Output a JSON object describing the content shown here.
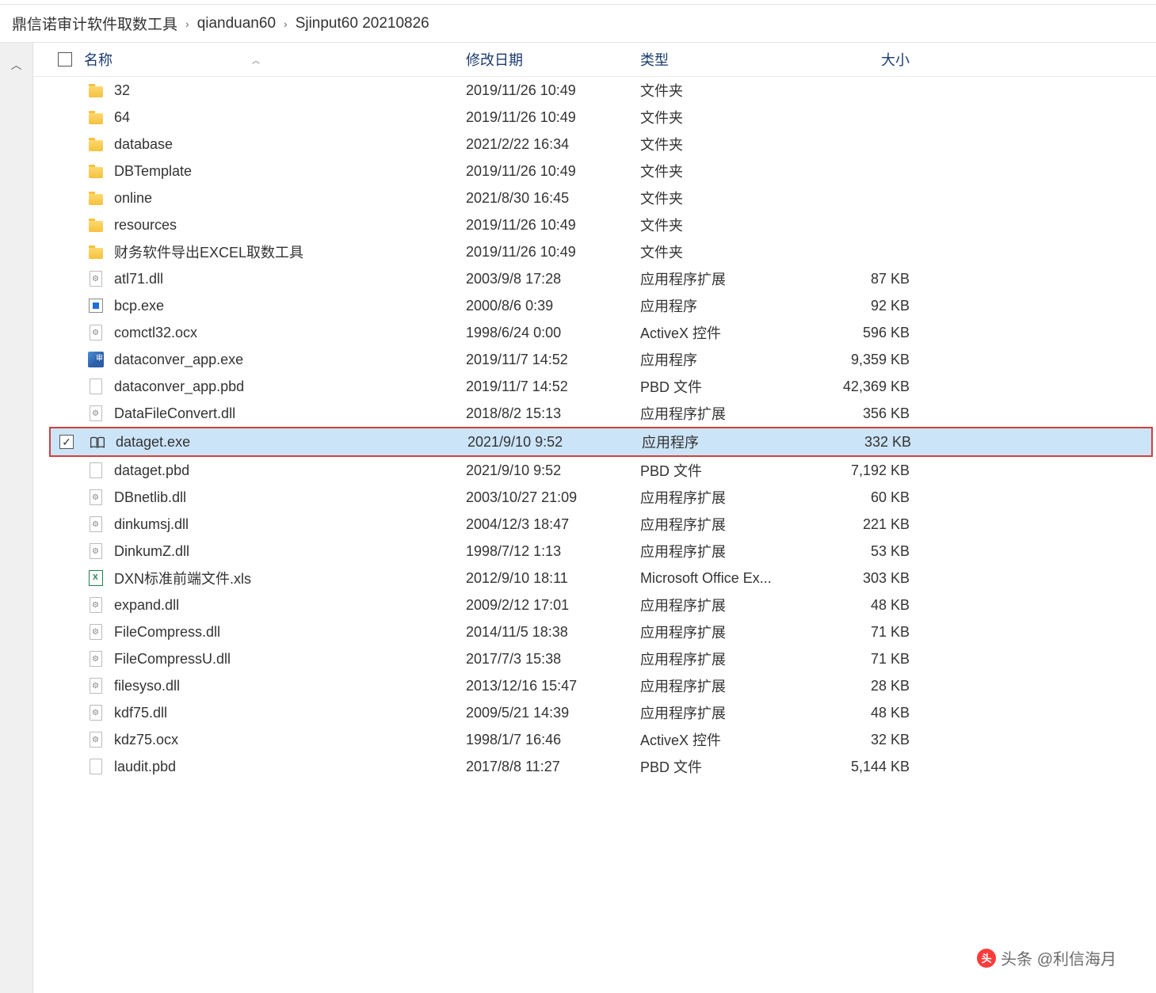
{
  "breadcrumb": {
    "item1": "鼎信诺审计软件取数工具",
    "item2": "qianduan60",
    "item3": "Sjinput60 20210826"
  },
  "columns": {
    "name": "名称",
    "date": "修改日期",
    "type": "类型",
    "size": "大小"
  },
  "types": {
    "folder": "文件夹",
    "appext": "应用程序扩展",
    "app": "应用程序",
    "activex": "ActiveX 控件",
    "pbd": "PBD 文件",
    "excel": "Microsoft Office Ex..."
  },
  "files": [
    {
      "icon": "folder",
      "name": "32",
      "date": "2019/11/26 10:49",
      "typekey": "folder",
      "size": ""
    },
    {
      "icon": "folder",
      "name": "64",
      "date": "2019/11/26 10:49",
      "typekey": "folder",
      "size": ""
    },
    {
      "icon": "folder",
      "name": "database",
      "date": "2021/2/22 16:34",
      "typekey": "folder",
      "size": ""
    },
    {
      "icon": "folder",
      "name": "DBTemplate",
      "date": "2019/11/26 10:49",
      "typekey": "folder",
      "size": ""
    },
    {
      "icon": "folder",
      "name": "online",
      "date": "2021/8/30 16:45",
      "typekey": "folder",
      "size": ""
    },
    {
      "icon": "folder",
      "name": "resources",
      "date": "2019/11/26 10:49",
      "typekey": "folder",
      "size": ""
    },
    {
      "icon": "folder",
      "name": "财务软件导出EXCEL取数工具",
      "date": "2019/11/26 10:49",
      "typekey": "folder",
      "size": ""
    },
    {
      "icon": "dll",
      "name": "atl71.dll",
      "date": "2003/9/8 17:28",
      "typekey": "appext",
      "size": "87 KB"
    },
    {
      "icon": "exe-blue",
      "name": "bcp.exe",
      "date": "2000/8/6 0:39",
      "typekey": "app",
      "size": "92 KB"
    },
    {
      "icon": "dll",
      "name": "comctl32.ocx",
      "date": "1998/6/24 0:00",
      "typekey": "activex",
      "size": "596 KB"
    },
    {
      "icon": "exe-color",
      "name": "dataconver_app.exe",
      "date": "2019/11/7 14:52",
      "typekey": "app",
      "size": "9,359 KB"
    },
    {
      "icon": "file",
      "name": "dataconver_app.pbd",
      "date": "2019/11/7 14:52",
      "typekey": "pbd",
      "size": "42,369 KB"
    },
    {
      "icon": "dll",
      "name": "DataFileConvert.dll",
      "date": "2018/8/2 15:13",
      "typekey": "appext",
      "size": "356 KB"
    },
    {
      "icon": "book",
      "name": "dataget.exe",
      "date": "2021/9/10 9:52",
      "typekey": "app",
      "size": "332 KB",
      "selected": true,
      "highlighted": true
    },
    {
      "icon": "file",
      "name": "dataget.pbd",
      "date": "2021/9/10 9:52",
      "typekey": "pbd",
      "size": "7,192 KB"
    },
    {
      "icon": "dll",
      "name": "DBnetlib.dll",
      "date": "2003/10/27 21:09",
      "typekey": "appext",
      "size": "60 KB"
    },
    {
      "icon": "dll",
      "name": "dinkumsj.dll",
      "date": "2004/12/3 18:47",
      "typekey": "appext",
      "size": "221 KB"
    },
    {
      "icon": "dll",
      "name": "DinkumZ.dll",
      "date": "1998/7/12 1:13",
      "typekey": "appext",
      "size": "53 KB"
    },
    {
      "icon": "xls",
      "name": "DXN标准前端文件.xls",
      "date": "2012/9/10 18:11",
      "typekey": "excel",
      "size": "303 KB"
    },
    {
      "icon": "dll",
      "name": "expand.dll",
      "date": "2009/2/12 17:01",
      "typekey": "appext",
      "size": "48 KB"
    },
    {
      "icon": "dll",
      "name": "FileCompress.dll",
      "date": "2014/11/5 18:38",
      "typekey": "appext",
      "size": "71 KB"
    },
    {
      "icon": "dll",
      "name": "FileCompressU.dll",
      "date": "2017/7/3 15:38",
      "typekey": "appext",
      "size": "71 KB"
    },
    {
      "icon": "dll",
      "name": "filesyso.dll",
      "date": "2013/12/16 15:47",
      "typekey": "appext",
      "size": "28 KB"
    },
    {
      "icon": "dll",
      "name": "kdf75.dll",
      "date": "2009/5/21 14:39",
      "typekey": "appext",
      "size": "48 KB"
    },
    {
      "icon": "dll",
      "name": "kdz75.ocx",
      "date": "1998/1/7 16:46",
      "typekey": "activex",
      "size": "32 KB"
    },
    {
      "icon": "file",
      "name": "laudit.pbd",
      "date": "2017/8/8 11:27",
      "typekey": "pbd",
      "size": "5,144 KB"
    }
  ],
  "watermark": {
    "text": "头条 @利信海月"
  }
}
